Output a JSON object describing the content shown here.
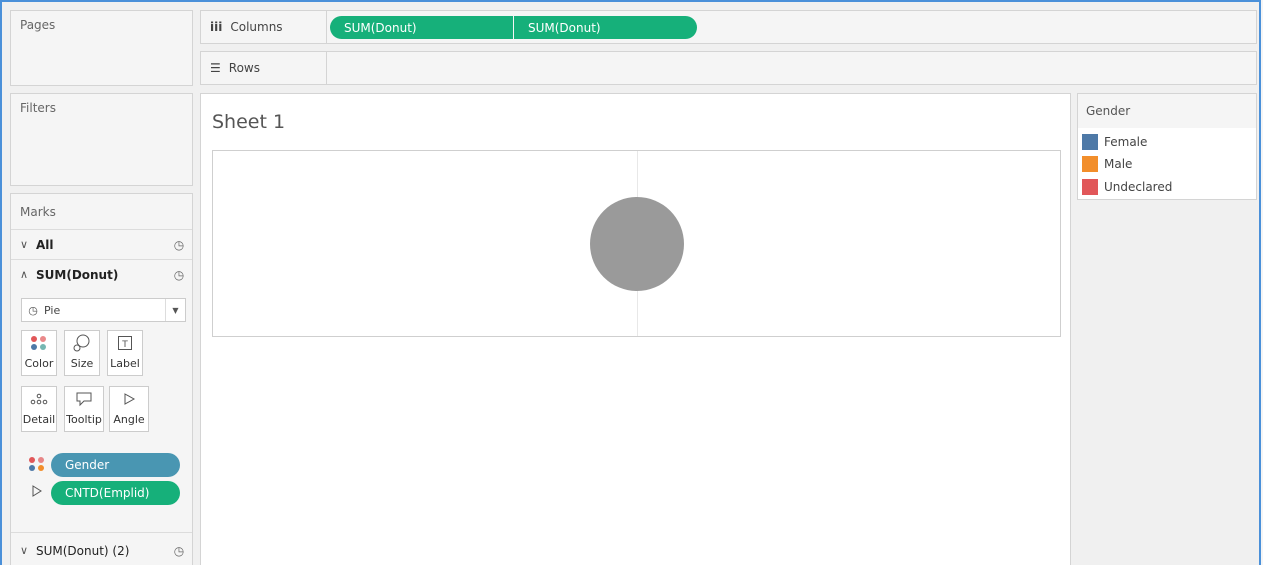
{
  "shelves": {
    "columns_label": "Columns",
    "rows_label": "Rows",
    "column_pills": [
      "SUM(Donut)",
      "SUM(Donut)"
    ]
  },
  "cards": {
    "pages": "Pages",
    "filters": "Filters",
    "marks": "Marks"
  },
  "marks": {
    "all_label": "All",
    "active_label": "SUM(Donut)",
    "second_label": "SUM(Donut) (2)",
    "mark_type": "Pie",
    "buttons": [
      "Color",
      "Size",
      "Label",
      "Detail",
      "Tooltip",
      "Angle"
    ],
    "pills": [
      "Gender",
      "CNTD(Emplid)"
    ]
  },
  "view": {
    "sheet_title": "Sheet 1"
  },
  "legend": {
    "title": "Gender",
    "items": [
      {
        "label": "Female",
        "color": "#4e79a7"
      },
      {
        "label": "Male",
        "color": "#f28e2b"
      },
      {
        "label": "Undeclared",
        "color": "#e15759"
      }
    ]
  },
  "colors": {
    "green_pill": "#16b07a",
    "blue_pill": "#4996b2",
    "donut_fill": "#9a9a9a",
    "frame_border": "#4a90d9"
  }
}
